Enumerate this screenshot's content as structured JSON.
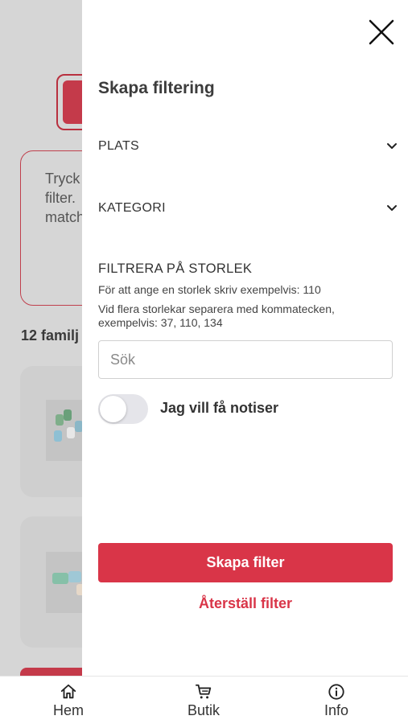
{
  "background": {
    "info_text": "Tryck\nfilter.\nmatch",
    "count_text": "12 familj"
  },
  "drawer": {
    "title": "Skapa filtering",
    "accordions": [
      {
        "label": "PLATS"
      },
      {
        "label": "KATEGORI"
      }
    ],
    "size_filter": {
      "heading": "FILTRERA PÅ STORLEK",
      "help_line1": "För att ange en storlek skriv exempelvis: 110",
      "help_line2": "Vid flera storlekar separera med kommatecken, exempelvis: 37, 110, 134",
      "search_placeholder": "Sök",
      "search_value": ""
    },
    "notifications": {
      "label": "Jag vill få notiser",
      "enabled": false
    },
    "create_button": "Skapa filter",
    "reset_link": "Återställ filter"
  },
  "tabbar": {
    "items": [
      {
        "label": "Hem",
        "icon": "home-icon"
      },
      {
        "label": "Butik",
        "icon": "cart-icon"
      },
      {
        "label": "Info",
        "icon": "info-icon"
      }
    ]
  },
  "colors": {
    "accent": "#d93548",
    "toggle_off": "#e5e5ea",
    "overlay": "#d6d6d6"
  }
}
